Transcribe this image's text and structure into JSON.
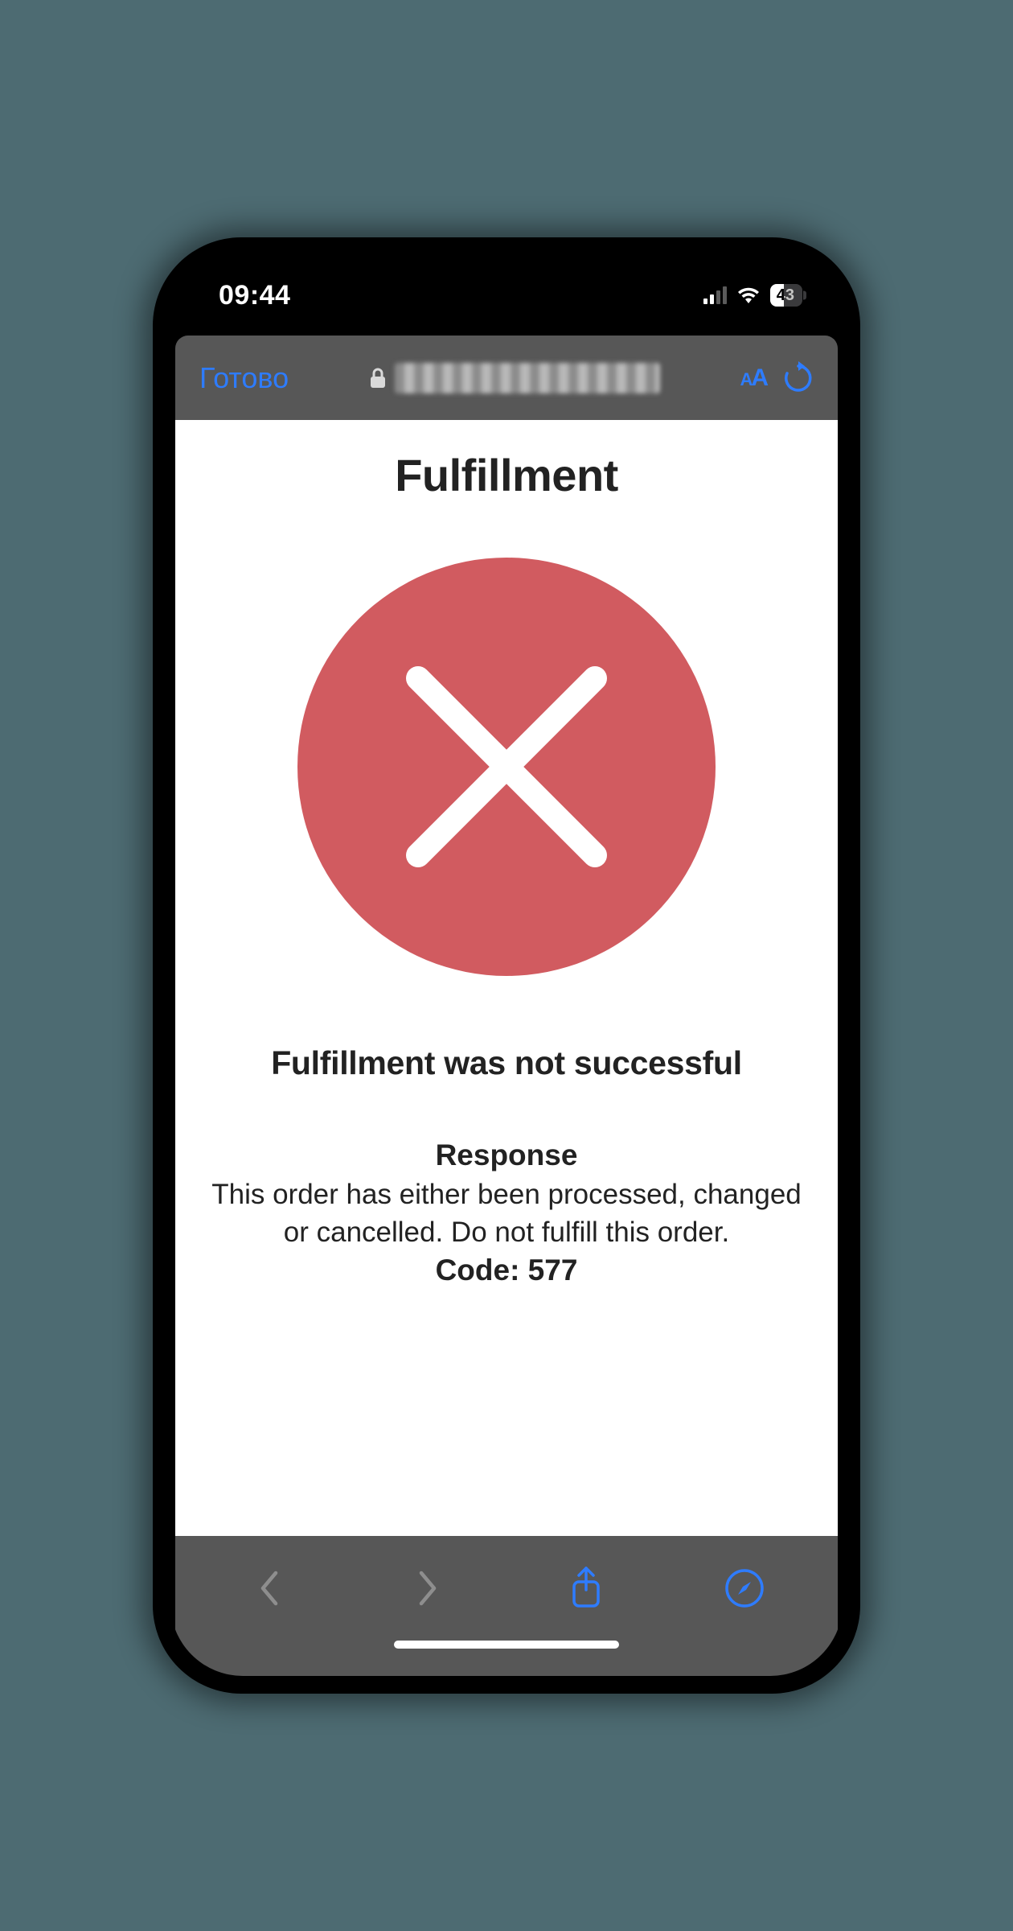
{
  "status_bar": {
    "time": "09:44",
    "battery_percent": "43"
  },
  "browser_header": {
    "done_label": "Готово"
  },
  "content": {
    "title": "Fulfillment",
    "status_message": "Fulfillment was not successful",
    "response_heading": "Response",
    "response_text": "This order has either been processed, changed or cancelled. Do not fulfill this order.",
    "code_label": "Code: 577"
  },
  "colors": {
    "error_circle": "#d15b60",
    "accent_blue": "#2e7cff"
  }
}
